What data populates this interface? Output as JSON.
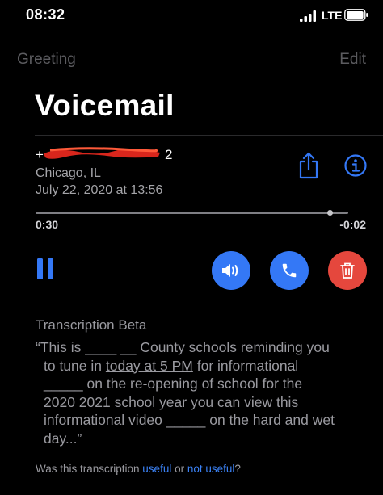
{
  "status_bar": {
    "time": "08:32",
    "network": "LTE"
  },
  "nav": {
    "back_label": "Greeting",
    "edit_label": "Edit"
  },
  "title": "Voicemail",
  "caller": {
    "number_visible_start": "+",
    "number_visible_end": "2",
    "location": "Chicago, IL",
    "date": "July 22, 2020 at 13:56"
  },
  "playback": {
    "elapsed": "0:30",
    "remaining": "-0:02",
    "progress": 0.94
  },
  "colors": {
    "accent_blue": "#3478f6",
    "delete_red": "#e5473d",
    "redaction_red": "#d8261c"
  },
  "icons": {
    "share": "share-icon",
    "info": "info-icon",
    "pause": "pause-icon",
    "speaker": "speaker-icon",
    "call": "phone-icon",
    "delete": "trash-icon"
  },
  "transcription": {
    "heading": "Transcription Beta",
    "lines": [
      {
        "parts": [
          "“This is ____ __ County schools reminding you"
        ]
      },
      {
        "parts": [
          "to tune in ",
          "today at 5 PM",
          " for informational"
        ],
        "underline_index": 1
      },
      {
        "parts": [
          "_____ on the re-opening of school for the"
        ]
      },
      {
        "parts": [
          "2020 2021 school year you can view this"
        ]
      },
      {
        "parts": [
          "informational video _____ on the hard and wet"
        ]
      },
      {
        "parts": [
          "day...”"
        ]
      }
    ]
  },
  "feedback": {
    "prefix": "Was this transcription ",
    "useful": "useful",
    "or": " or ",
    "not_useful": "not useful",
    "suffix": "?"
  }
}
